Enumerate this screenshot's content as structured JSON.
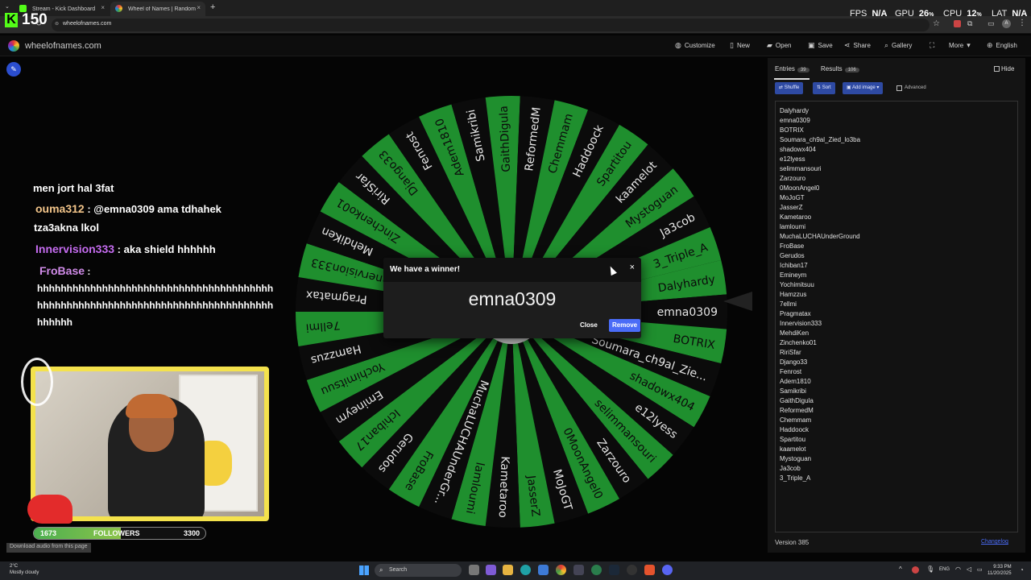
{
  "browser": {
    "tabs": [
      {
        "label": "Stream - Kick Dashboard",
        "active": false
      },
      {
        "label": "Wheel of Names | Random name",
        "active": true
      }
    ],
    "new_tab": "+",
    "address": "wheelofnames.com"
  },
  "overlay": {
    "kick_logo": "K",
    "viewer_count": "150",
    "fps_label": "FPS",
    "fps_value": "N/A",
    "gpu_label": "GPU",
    "gpu_value": "26",
    "gpu_unit": "%",
    "cpu_label": "CPU",
    "cpu_value": "12",
    "cpu_unit": "%",
    "lat_label": "LAT",
    "lat_value": "N/A"
  },
  "app": {
    "site_title": "wheelofnames.com",
    "nav": {
      "customize": "Customize",
      "new": "New",
      "open": "Open",
      "save": "Save",
      "share": "Share",
      "gallery": "Gallery",
      "more": "More",
      "language": "English"
    }
  },
  "chat": [
    {
      "user": "",
      "message": "men jort hal 3fat",
      "color": "#ffffff"
    },
    {
      "user": "ouma312",
      "message": ": @emna0309 ama tdhahek",
      "message2": "tza3akna lkol",
      "color": "#f3c58a"
    },
    {
      "user": "Innervision333",
      "message": ": aka shield hhhhhh",
      "color": "#c56cf0"
    },
    {
      "user": "FroBase",
      "message": ":",
      "line2": "hhhhhhhhhhhhhhhhhhhhhhhhhhhhhhhhhhhhhhhh",
      "line3": "hhhhhhhhhhhhhhhhhhhhhhhhhhhhhhhhhhhhhhhh",
      "line4": "hhhhhh",
      "color": "#d08be8"
    }
  ],
  "followers_bar": {
    "current": "1673",
    "label": "FOLLOWERS",
    "goal": "3300",
    "progress": 0.507
  },
  "wheel": {
    "colors": {
      "green": "#1f8f2e",
      "dark": "#0b0b0b"
    },
    "segments": [
      "Dalyhardy",
      "emna0309",
      "BOTRIX",
      "Soumara_ch9al_Zie...",
      "shadowx404",
      "e12lyess",
      "selimmansouri",
      "Zarzouro",
      "0MoonAngel0",
      "MoJoGT",
      "JasserZ",
      "Kametaroo",
      "lamloumi",
      "MuchaLUCHAUnderGr...",
      "FroBase",
      "Gerudos",
      "Ichiban17",
      "Emineym",
      "Yochimitsuu",
      "Hamzzus",
      "7ellmi",
      "Pragmatax",
      "Innervision333",
      "MehdiKen",
      "Zinchenko01",
      "RiriSfar",
      "Django33",
      "Fenrost",
      "Adem1810",
      "Samikribi",
      "GaithDigula",
      "ReformedM",
      "Chemmam",
      "Haddoock",
      "Spartitou",
      "kaamelot",
      "Mystoguan",
      "Ja3cob",
      "3_Triple_A"
    ]
  },
  "dialog": {
    "title": "We have a winner!",
    "close_x": "×",
    "winner": "emna0309",
    "close_label": "Close",
    "remove_label": "Remove"
  },
  "panel": {
    "entries_tab": "Entries",
    "entries_count": "39",
    "results_tab": "Results",
    "results_count": "106",
    "hide_label": "Hide",
    "shuffle_label": "Shuffle",
    "sort_label": "Sort",
    "add_image_label": "Add image",
    "advanced_label": "Advanced",
    "entries": [
      "Dalyhardy",
      "emna0309",
      "BOTRIX",
      "Soumara_ch9al_Zied_lo3ba",
      "shadowx404",
      "e12lyess",
      "selimmansouri",
      "Zarzouro",
      "0MoonAngel0",
      "MoJoGT",
      "JasserZ",
      "Kametaroo",
      "lamloumi",
      "MuchaLUCHAUnderGround",
      "FroBase",
      "Gerudos",
      "Ichiban17",
      "Emineym",
      "Yochimitsuu",
      "Hamzzus",
      "7ellmi",
      "Pragmatax",
      "Innervision333",
      "MehdiKen",
      "Zinchenko01",
      "RiriSfar",
      "Django33",
      "Fenrost",
      "Adem1810",
      "Samikribi",
      "GaithDigula",
      "ReformedM",
      "Chemmam",
      "Haddoock",
      "Spartitou",
      "kaamelot",
      "Mystoguan",
      "Ja3cob",
      "3_Triple_A"
    ],
    "version": "Version 385",
    "changelog": "Changelog"
  },
  "download_bar": "Download audio from this page",
  "taskbar": {
    "weather_temp": "2°C",
    "weather_desc": "Mostly cloudy",
    "search": "Search",
    "lang": "ENG",
    "time": "9:33 PM",
    "date": "11/20/2025"
  }
}
